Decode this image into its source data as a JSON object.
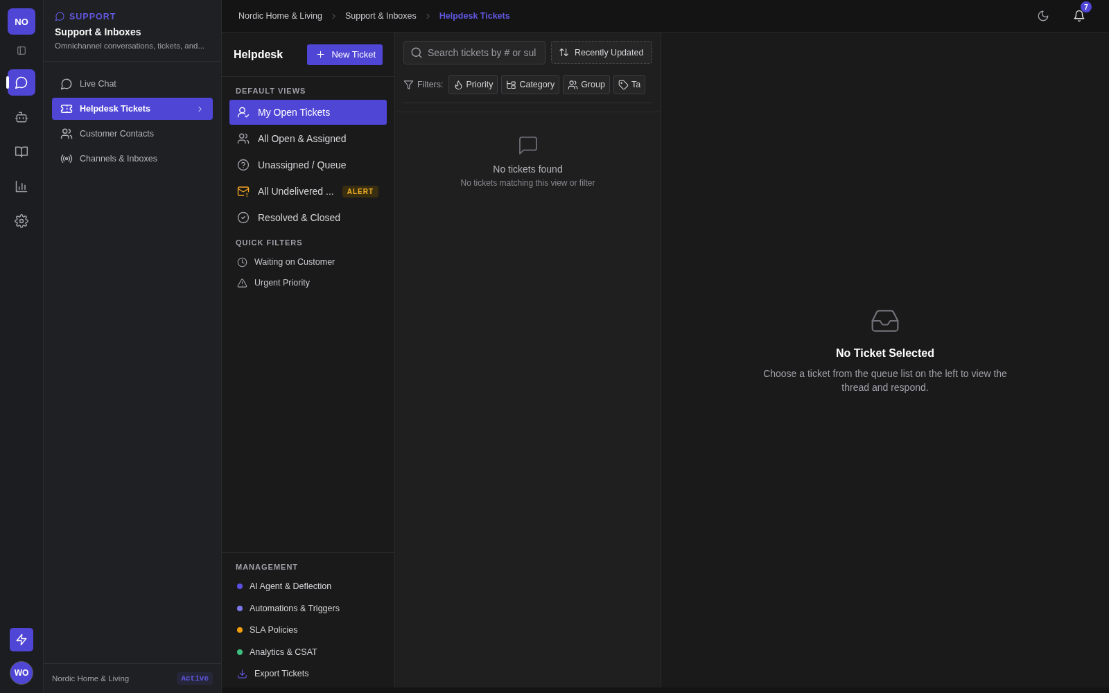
{
  "rail": {
    "workspace_badge": "NO",
    "items": [
      {
        "selected": true
      },
      {
        "selected": false
      },
      {
        "selected": false
      },
      {
        "selected": false
      },
      {
        "selected": false
      }
    ],
    "user_avatar": "WO"
  },
  "sidebar": {
    "section_label": "SUPPORT",
    "title": "Support & Inboxes",
    "subtitle": "Omnichannel conversations, tickets, and...",
    "items": [
      {
        "label": "Live Chat",
        "selected": false
      },
      {
        "label": "Helpdesk Tickets",
        "selected": true
      },
      {
        "label": "Customer Contacts",
        "selected": false
      },
      {
        "label": "Channels & Inboxes",
        "selected": false
      }
    ],
    "footer": {
      "org": "Nordic Home & Living",
      "status": "Active"
    }
  },
  "breadcrumbs": [
    {
      "label": "Nordic Home & Living",
      "selected": false
    },
    {
      "label": "Support & Inboxes",
      "selected": false
    },
    {
      "label": "Helpdesk Tickets",
      "selected": true
    }
  ],
  "notifications": {
    "count": "7"
  },
  "helpdesk": {
    "title": "Helpdesk",
    "new_button": "New Ticket",
    "default_views_label": "DEFAULT VIEWS",
    "views": [
      {
        "label": "My Open Tickets",
        "selected": true
      },
      {
        "label": "All Open & Assigned",
        "selected": false
      },
      {
        "label": "Unassigned / Queue",
        "selected": false
      },
      {
        "label": "All Undelivered ...",
        "selected": false,
        "badge": "ALERT"
      },
      {
        "label": "Resolved & Closed",
        "selected": false
      }
    ],
    "quick_filters_label": "QUICK FILTERS",
    "quick_filters": [
      {
        "label": "Waiting on Customer"
      },
      {
        "label": "Urgent Priority"
      }
    ],
    "management_label": "MANAGEMENT",
    "management": [
      {
        "kind": "dot",
        "label": "AI Agent & Deflection",
        "color": "#5b4fe0"
      },
      {
        "kind": "dot",
        "label": "Automations & Triggers",
        "color": "#7b78e8"
      },
      {
        "kind": "dot",
        "label": "SLA Policies",
        "color": "#f29e0c"
      },
      {
        "kind": "dot",
        "label": "Analytics & CSAT",
        "color": "#3fbf7f"
      },
      {
        "kind": "action",
        "label": "Export Tickets"
      }
    ]
  },
  "ticket_list": {
    "search": {
      "placeholder": "Search tickets by # or sul"
    },
    "sort_button": "Recently Updated",
    "filters_label": "Filters:",
    "filters": [
      "Priority",
      "Category",
      "Group",
      "Ta"
    ],
    "empty": {
      "title": "No tickets found",
      "message": "No tickets matching this view or filter"
    }
  },
  "detail": {
    "empty": {
      "title": "No Ticket Selected",
      "message": "Choose a ticket from the queue list on the left to view the thread and respond."
    }
  }
}
